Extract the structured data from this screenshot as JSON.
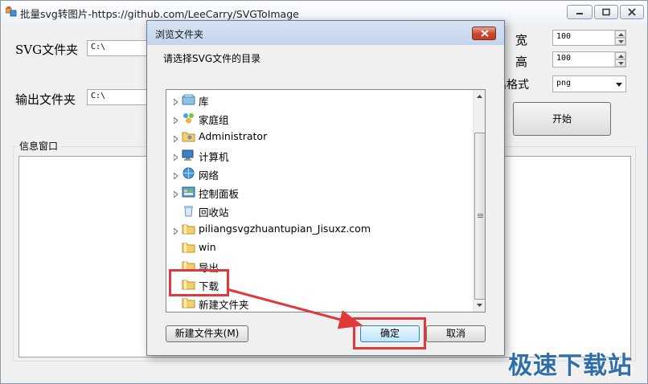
{
  "window": {
    "title": "批量svg转图片-https://github.com/LeeCarry/SVGToImage"
  },
  "form": {
    "svg_folder_label": "SVG文件夹",
    "svg_folder_value": "C:\\",
    "output_folder_label": "输出文件夹",
    "output_folder_value": "C:\\",
    "width_label": "宽",
    "width_value": "100",
    "height_label": "高",
    "height_value": "100",
    "format_label": "导出格式",
    "format_value": "png",
    "start_button": "开始",
    "info_group_label": "信息窗口"
  },
  "dialog": {
    "title": "浏览文件夹",
    "description": "请选择SVG文件的目录",
    "tree_items": [
      {
        "label": "库",
        "icon": "library-icon",
        "expandable": true
      },
      {
        "label": "家庭组",
        "icon": "homegroup-icon",
        "expandable": true
      },
      {
        "label": "Administrator",
        "icon": "user-folder-icon",
        "expandable": true
      },
      {
        "label": "计算机",
        "icon": "computer-icon",
        "expandable": true
      },
      {
        "label": "网络",
        "icon": "network-icon",
        "expandable": true
      },
      {
        "label": "控制面板",
        "icon": "control-panel-icon",
        "expandable": true
      },
      {
        "label": "回收站",
        "icon": "recycle-bin-icon",
        "expandable": false
      },
      {
        "label": "piliangsvgzhuantupian_Jisuxz.com",
        "icon": "folder-icon",
        "expandable": true
      },
      {
        "label": "win",
        "icon": "folder-icon",
        "expandable": false
      },
      {
        "label": "导出",
        "icon": "folder-icon",
        "expandable": false
      },
      {
        "label": "下载",
        "icon": "folder-icon",
        "expandable": false,
        "selected": true
      },
      {
        "label": "新建文件夹",
        "icon": "folder-icon",
        "expandable": false
      }
    ],
    "new_folder_button": "新建文件夹(M)",
    "ok_button": "确定",
    "cancel_button": "取消"
  },
  "watermark": "极速下载站",
  "colors": {
    "annotation_red": "#e1383a",
    "watermark_blue": "#2f6eaa",
    "selection_border": "#7da2ce"
  }
}
